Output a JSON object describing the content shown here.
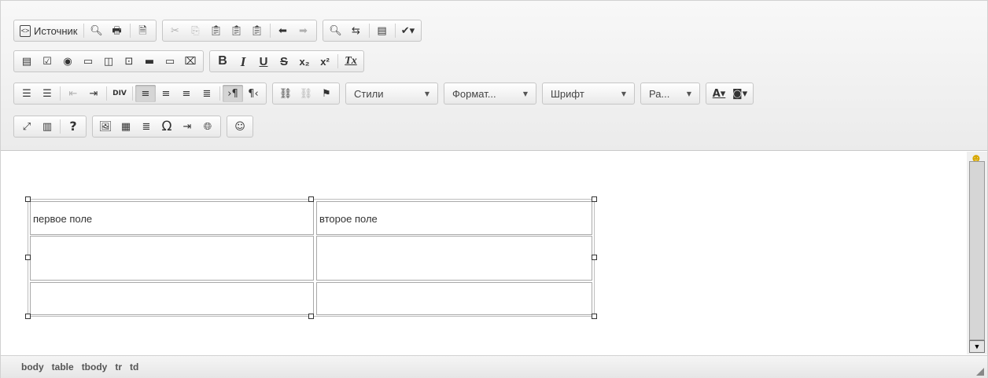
{
  "toolbar": {
    "source_label": "Источник",
    "styles_label": "Стили",
    "format_label": "Формат...",
    "font_label": "Шрифт",
    "size_label": "Ра...",
    "bold": "B",
    "italic": "I",
    "underline": "U",
    "strike": "S",
    "subscript": "x₂",
    "superscript": "x²",
    "remove_format": "Tx",
    "question": "?",
    "omega": "Ω",
    "div_label": "DIV"
  },
  "content": {
    "table": {
      "rows": [
        [
          "первое поле",
          "второе поле"
        ],
        [
          "",
          ""
        ],
        [
          "",
          ""
        ]
      ]
    }
  },
  "status": {
    "path": [
      "body",
      "table",
      "tbody",
      "tr",
      "td"
    ]
  }
}
